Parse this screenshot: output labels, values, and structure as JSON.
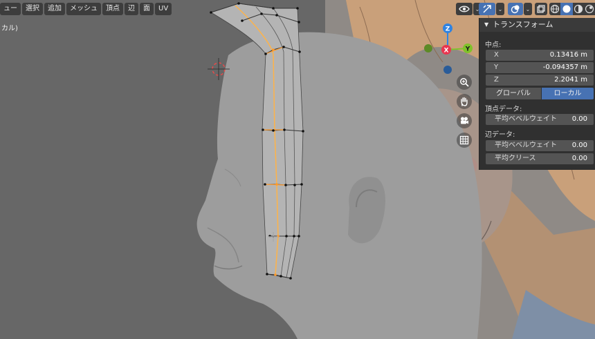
{
  "menubar": {
    "items": [
      "ュー",
      "選択",
      "追加",
      "メッシュ",
      "頂点",
      "辺",
      "面",
      "UV"
    ]
  },
  "viewport": {
    "label": "カル)"
  },
  "gizmo": {
    "z": "Z",
    "y": "Y",
    "x": "X"
  },
  "npanel": {
    "transform_title": "トランスフォーム",
    "median_label": "中点:",
    "x_label": "X",
    "x_value": "0.13416 m",
    "y_label": "Y",
    "y_value": "-0.094357 m",
    "z_label": "Z",
    "z_value": "2.2041 m",
    "global_label": "グローバル",
    "local_label": "ローカル",
    "vertex_data_label": "頂点データ:",
    "vertex_bevel_label": "平均ベベルウェイト",
    "vertex_bevel_value": "0.00",
    "edge_data_label": "辺データ:",
    "edge_bevel_label": "平均ベベルウェイト",
    "edge_bevel_value": "0.00",
    "edge_crease_label": "平均クリース",
    "edge_crease_value": "0.00"
  },
  "icons": [
    "eye-icon",
    "chevron-down-icon",
    "gizmo-toggle-icon",
    "overlay-icon",
    "xray-icon",
    "wireframe-shading-icon",
    "solid-shading-icon",
    "material-shading-icon",
    "rendered-shading-icon",
    "zoom-icon",
    "hand-pan-icon",
    "camera-icon",
    "grid-icon",
    "3d-cursor-icon"
  ],
  "colors": {
    "viewport_bg": "#676767",
    "panel_bg": "#303030",
    "field_bg": "#545454",
    "accent": "#4772b3",
    "edge_selected": "#ffa733",
    "gizmo_x": "#e8364f",
    "gizmo_y": "#7fc22a",
    "gizmo_z": "#2f83e2"
  }
}
